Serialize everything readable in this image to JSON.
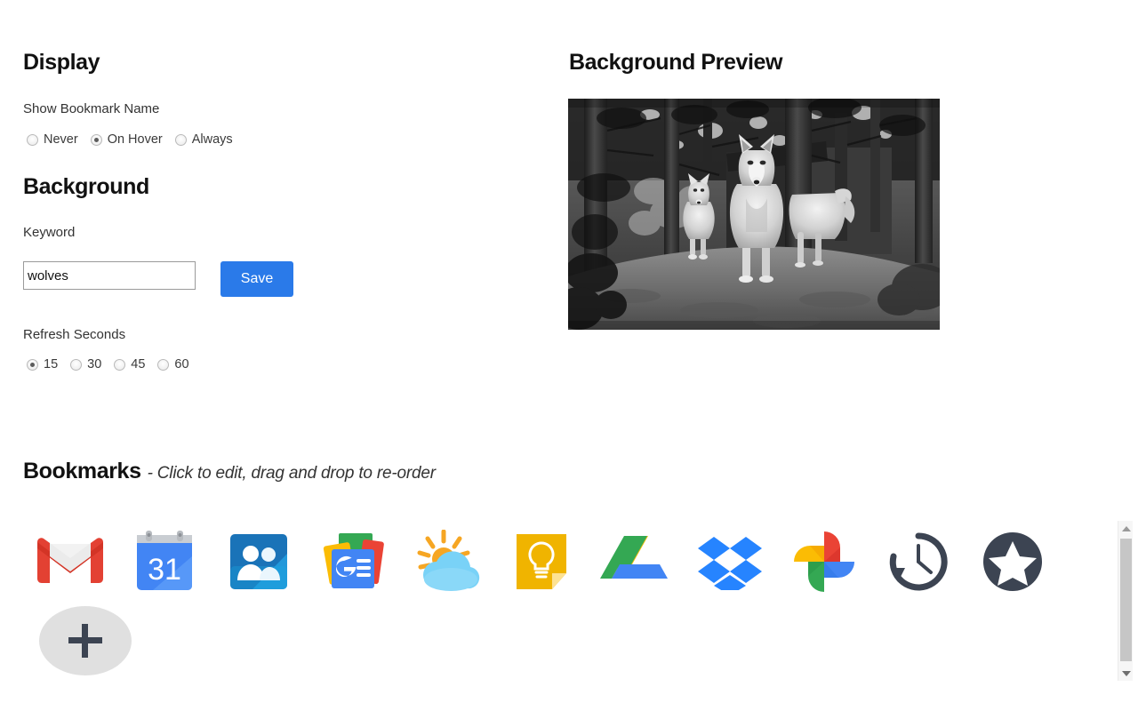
{
  "display": {
    "title": "Display",
    "show_bookmark_name_label": "Show Bookmark Name",
    "show_bookmark_name_options": [
      {
        "label": "Never",
        "checked": false
      },
      {
        "label": "On Hover",
        "checked": true
      },
      {
        "label": "Always",
        "checked": false
      }
    ],
    "show_bookmark_name_selected": "On Hover"
  },
  "background": {
    "title": "Background",
    "keyword_label": "Keyword",
    "keyword_value": "wolves",
    "keyword_placeholder": "",
    "save_label": "Save",
    "save_color": "#2a7ae9",
    "refresh_label": "Refresh Seconds",
    "refresh_options": [
      {
        "label": "15",
        "checked": true
      },
      {
        "label": "30",
        "checked": false
      },
      {
        "label": "45",
        "checked": false
      },
      {
        "label": "60",
        "checked": false
      }
    ],
    "refresh_selected": "15"
  },
  "preview": {
    "title": "Background Preview",
    "image_alt": "black and white photo of three wolves standing in a forest"
  },
  "bookmarks": {
    "title": "Bookmarks",
    "subtitle": "- Click to edit, drag and drop to re-order",
    "items": [
      {
        "name": "gmail",
        "label": "Gmail"
      },
      {
        "name": "google-calendar",
        "label": "Calendar",
        "day": "31"
      },
      {
        "name": "google-contacts",
        "label": "Contacts"
      },
      {
        "name": "google-news",
        "label": "News"
      },
      {
        "name": "weather",
        "label": "Weather"
      },
      {
        "name": "google-keep",
        "label": "Keep"
      },
      {
        "name": "google-drive",
        "label": "Drive"
      },
      {
        "name": "dropbox",
        "label": "Dropbox"
      },
      {
        "name": "google-photos",
        "label": "Photos"
      },
      {
        "name": "history",
        "label": "History"
      },
      {
        "name": "bookmarks-star",
        "label": "Bookmarks"
      }
    ],
    "add_label": "+"
  },
  "scrollbar": {
    "up_label": "scroll up",
    "down_label": "scroll down"
  }
}
